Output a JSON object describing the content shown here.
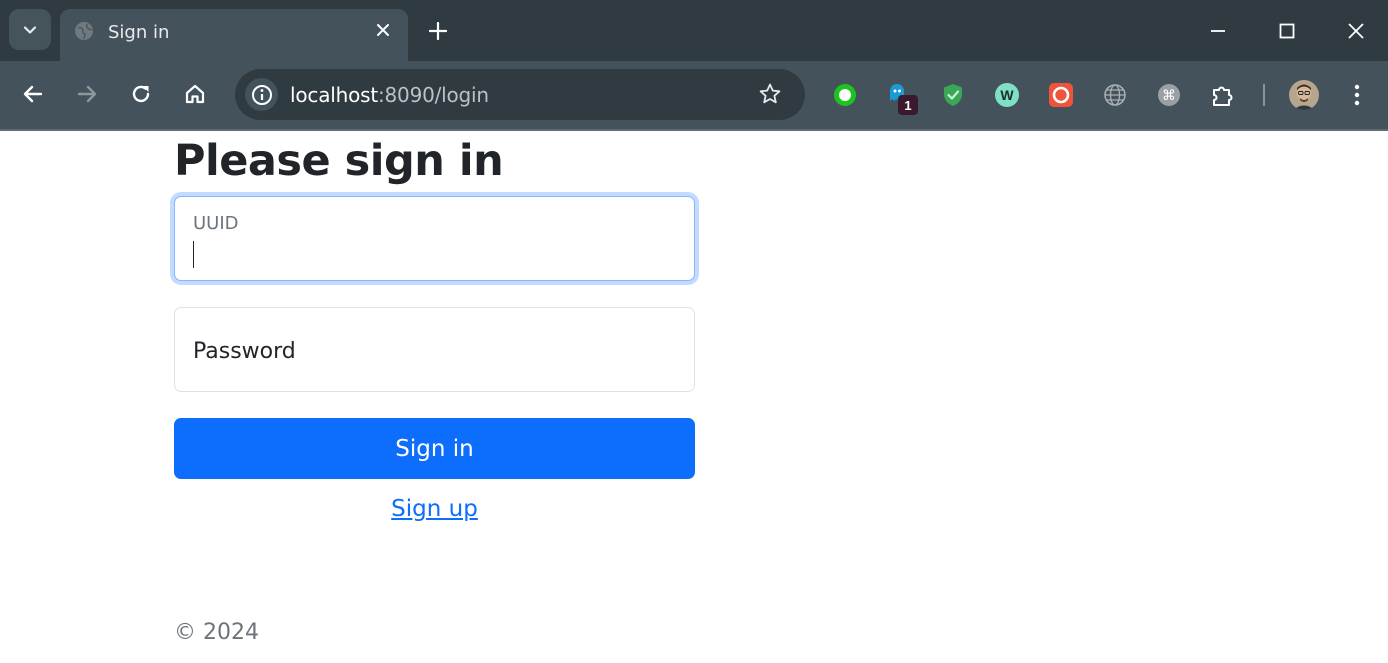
{
  "browser": {
    "tab_title": "Sign in",
    "url_host": "localhost",
    "url_rest": ":8090/login",
    "extensions": [
      {
        "name": "green-circle-extension-icon",
        "color": "#1ec41e"
      },
      {
        "name": "ghost-extension-icon",
        "color": "#1a9bd7",
        "badge": "1"
      },
      {
        "name": "shield-check-extension-icon",
        "color": "#3aa757"
      },
      {
        "name": "w-extension-icon",
        "color": "#7fe0c4"
      },
      {
        "name": "record-extension-icon",
        "color": "#f0533c"
      },
      {
        "name": "globe-grid-extension-icon",
        "color": "#9aa0a6"
      },
      {
        "name": "command-extension-icon",
        "color": "#9aa0a6"
      }
    ]
  },
  "page": {
    "heading": "Please sign in",
    "uuid_label": "UUID",
    "password_label": "Password",
    "submit_label": "Sign in",
    "signup_link": "Sign up",
    "footer": "© 2024"
  },
  "colors": {
    "primary": "#0d6efd",
    "chrome_dark": "#2f3a41",
    "chrome_light": "#44535b"
  }
}
